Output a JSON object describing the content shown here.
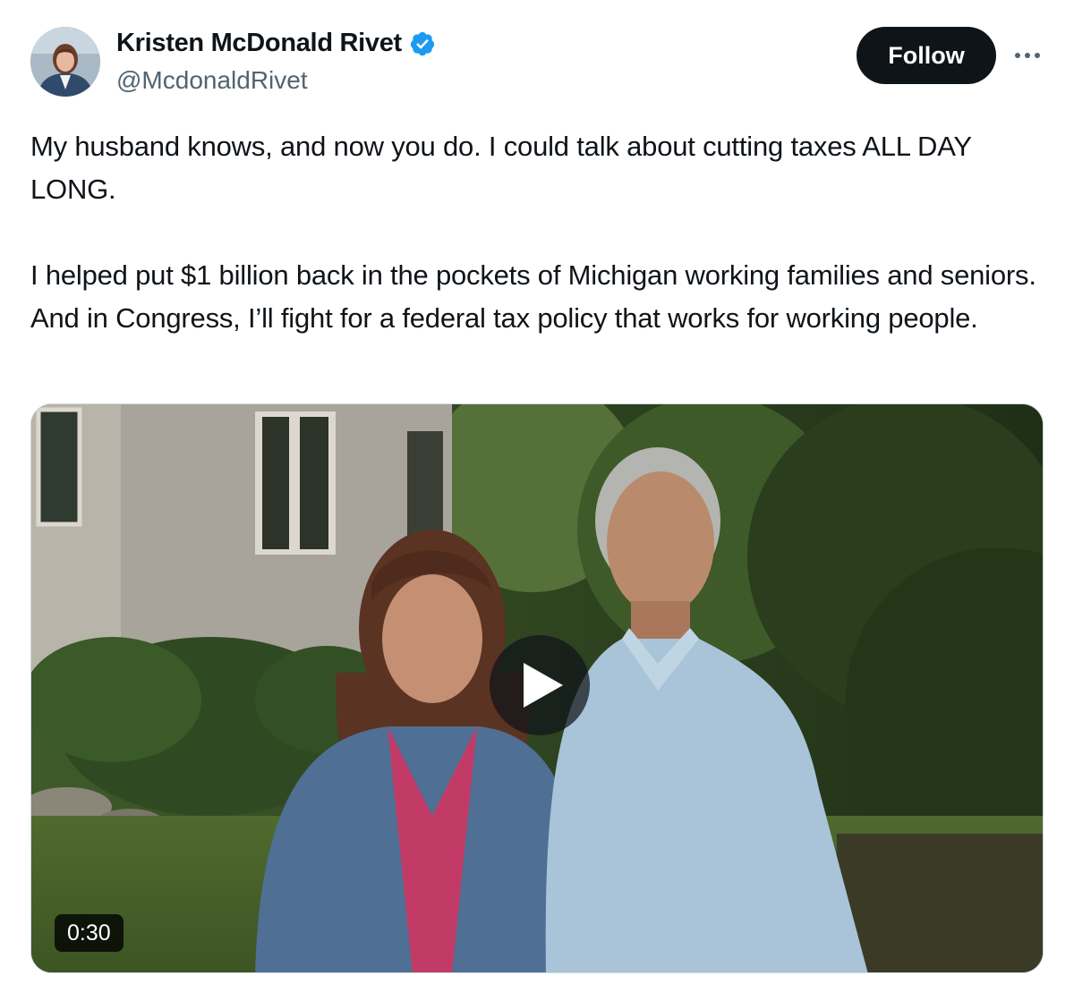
{
  "author": {
    "display_name": "Kristen McDonald Rivet",
    "handle": "@McdonaldRivet",
    "verified": true,
    "avatar_icon": "profile-photo"
  },
  "actions": {
    "follow_label": "Follow",
    "more_icon": "more-horizontal-icon"
  },
  "tweet": {
    "paragraphs": [
      "My husband knows, and now you do. I could talk about cutting taxes ALL DAY LONG.",
      "I helped put $1 billion back in the pockets of Michigan working families and seniors. And in Congress, I’ll fight for a federal tax policy that works for working people."
    ]
  },
  "media": {
    "type": "video",
    "duration": "0:30",
    "play_icon": "play-icon"
  },
  "colors": {
    "text": "#0f1419",
    "secondary_text": "#536471",
    "verified_badge": "#1d9bf0",
    "follow_button_bg": "#0f1419",
    "follow_button_text": "#ffffff"
  }
}
